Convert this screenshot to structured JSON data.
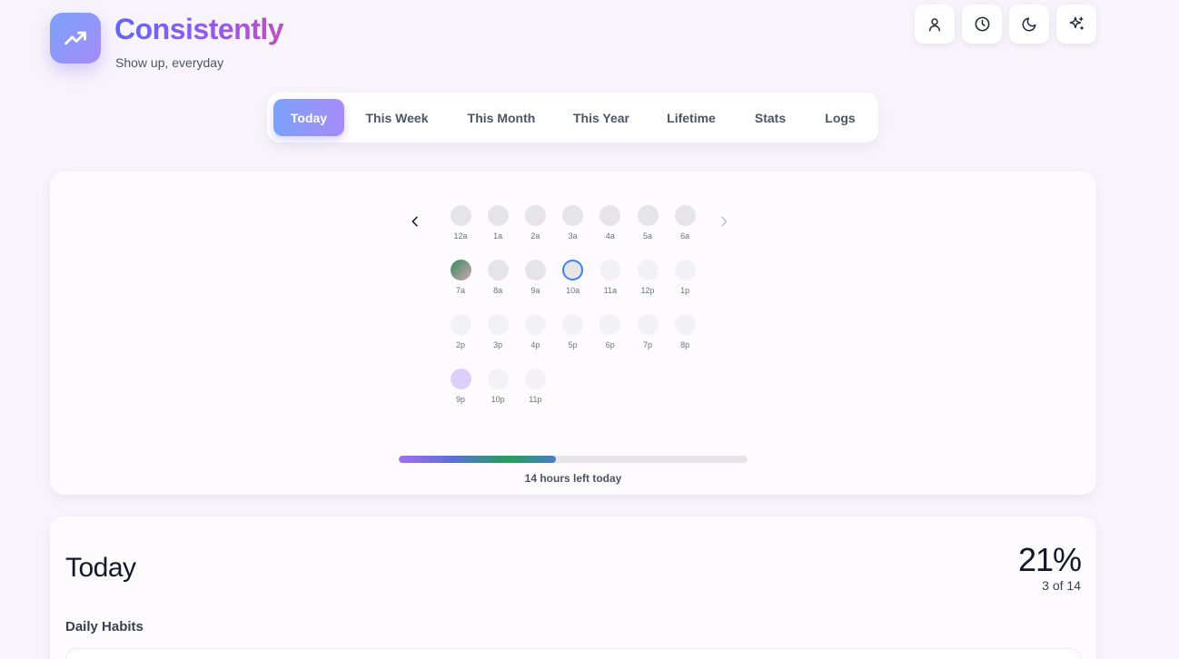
{
  "header": {
    "app_name": "Consistently",
    "tagline": "Show up, everyday",
    "logo_icon": "trending-up-icon",
    "actions": [
      {
        "name": "profile-button",
        "icon": "user-icon"
      },
      {
        "name": "history-button",
        "icon": "clock-icon"
      },
      {
        "name": "theme-toggle-button",
        "icon": "moon-icon"
      },
      {
        "name": "sparkles-button",
        "icon": "sparkles-icon"
      }
    ]
  },
  "tabs": [
    {
      "label": "Today",
      "active": true
    },
    {
      "label": "This Week",
      "active": false
    },
    {
      "label": "This Month",
      "active": false
    },
    {
      "label": "This Year",
      "active": false
    },
    {
      "label": "Lifetime",
      "active": false
    },
    {
      "label": "Stats",
      "active": false
    },
    {
      "label": "Logs",
      "active": false
    }
  ],
  "hours": {
    "prev_icon": "chevron-left-icon",
    "next_icon": "chevron-right-icon",
    "cells": [
      {
        "label": "12a",
        "state": "past"
      },
      {
        "label": "1a",
        "state": "past"
      },
      {
        "label": "2a",
        "state": "past"
      },
      {
        "label": "3a",
        "state": "past"
      },
      {
        "label": "4a",
        "state": "past"
      },
      {
        "label": "5a",
        "state": "past"
      },
      {
        "label": "6a",
        "state": "past"
      },
      {
        "label": "7a",
        "state": "done"
      },
      {
        "label": "8a",
        "state": "past"
      },
      {
        "label": "9a",
        "state": "past"
      },
      {
        "label": "10a",
        "state": "current"
      },
      {
        "label": "11a",
        "state": "future"
      },
      {
        "label": "12p",
        "state": "future"
      },
      {
        "label": "1p",
        "state": "future"
      },
      {
        "label": "2p",
        "state": "future"
      },
      {
        "label": "3p",
        "state": "future"
      },
      {
        "label": "4p",
        "state": "future"
      },
      {
        "label": "5p",
        "state": "future"
      },
      {
        "label": "6p",
        "state": "future"
      },
      {
        "label": "7p",
        "state": "future"
      },
      {
        "label": "8p",
        "state": "future"
      },
      {
        "label": "9p",
        "state": "planned"
      },
      {
        "label": "10p",
        "state": "future"
      },
      {
        "label": "11p",
        "state": "future"
      }
    ],
    "day_progress_percent": 45,
    "remaining_text": "14 hours left today"
  },
  "today": {
    "title": "Today",
    "percent": "21%",
    "count": "3 of 14",
    "section": "Daily Habits"
  },
  "colors": {
    "accent_start": "#7aa2f8",
    "accent_end": "#a78bfa",
    "current_hour_ring": "#3b82f6"
  }
}
